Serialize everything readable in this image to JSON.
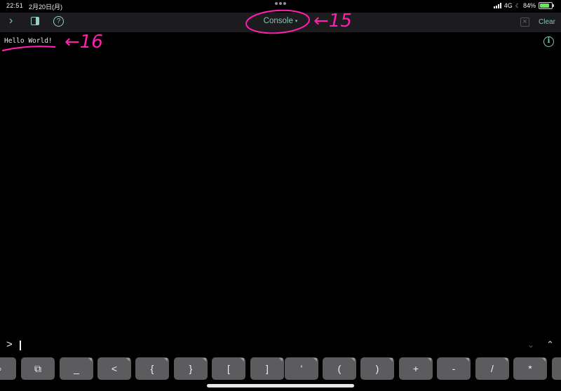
{
  "status": {
    "time": "22:51",
    "date": "2月20日(月)",
    "network": "4G",
    "battery": "84%",
    "battery_level": 0.84
  },
  "toolbar": {
    "title": "Console",
    "title_caret": "▾",
    "clear_label": "Clear",
    "icons": [
      "chevron-right-icon",
      "sidebar-toggle-icon",
      "help-icon",
      "close-icon"
    ]
  },
  "console": {
    "output": "Hello World!",
    "prompt": ">"
  },
  "keyboard": {
    "keys": [
      "⌕",
      "⧉",
      "_",
      "<",
      "{",
      "}",
      "[",
      "]",
      "'",
      "(",
      ")",
      "+",
      "-",
      "/",
      "*"
    ]
  },
  "annotations": {
    "title_note": "←15",
    "output_note": "←16",
    "color": "#ff1fb0"
  },
  "colors": {
    "accent": "#7fc7b4",
    "toolbar_bg": "#1c1c1e",
    "key_bg": "#5c5c5f"
  }
}
